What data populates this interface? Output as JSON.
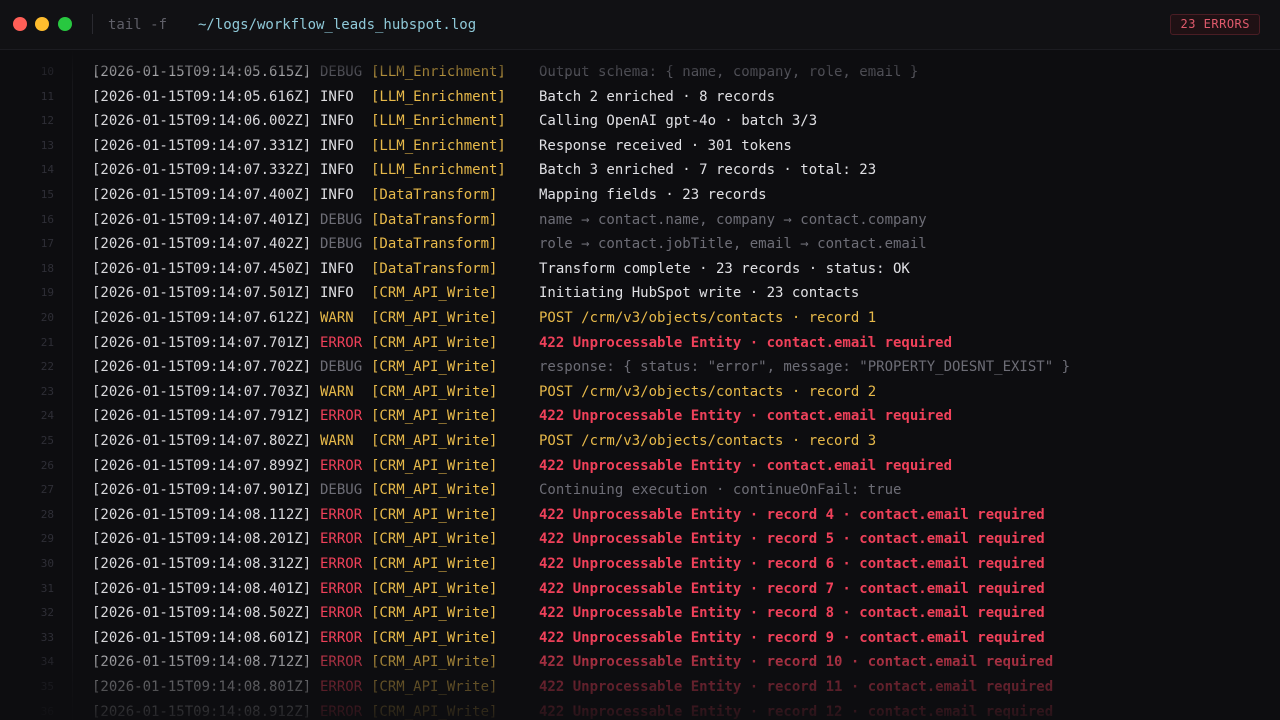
{
  "titlebar": {
    "command": "tail -f",
    "path": "~/logs/workflow_leads_hubspot.log",
    "error_badge": "23 ERRORS"
  },
  "colors": {
    "background": "#0d0d10",
    "info": "#e0e0e4",
    "debug": "#6d6d76",
    "warn": "#e7b94a",
    "error": "#f0415a",
    "source": "#e7b94a",
    "path": "#8fc9d8"
  },
  "log_lines": [
    {
      "n": "10",
      "ts": "[2026-01-15T09:14:05.615Z]",
      "level": "DEBUG",
      "source": "[LLM_Enrichment]",
      "message": "Output schema: { name, company, role, email }"
    },
    {
      "n": "11",
      "ts": "[2026-01-15T09:14:05.616Z]",
      "level": "INFO",
      "source": "[LLM_Enrichment]",
      "message": "Batch 2 enriched · 8 records"
    },
    {
      "n": "12",
      "ts": "[2026-01-15T09:14:06.002Z]",
      "level": "INFO",
      "source": "[LLM_Enrichment]",
      "message": "Calling OpenAI gpt-4o · batch 3/3"
    },
    {
      "n": "13",
      "ts": "[2026-01-15T09:14:07.331Z]",
      "level": "INFO",
      "source": "[LLM_Enrichment]",
      "message": "Response received · 301 tokens"
    },
    {
      "n": "14",
      "ts": "[2026-01-15T09:14:07.332Z]",
      "level": "INFO",
      "source": "[LLM_Enrichment]",
      "message": "Batch 3 enriched · 7 records · total: 23"
    },
    {
      "n": "15",
      "ts": "[2026-01-15T09:14:07.400Z]",
      "level": "INFO",
      "source": "[DataTransform]",
      "message": "Mapping fields · 23 records"
    },
    {
      "n": "16",
      "ts": "[2026-01-15T09:14:07.401Z]",
      "level": "DEBUG",
      "source": "[DataTransform]",
      "message": "name → contact.name, company → contact.company"
    },
    {
      "n": "17",
      "ts": "[2026-01-15T09:14:07.402Z]",
      "level": "DEBUG",
      "source": "[DataTransform]",
      "message": "role → contact.jobTitle, email → contact.email"
    },
    {
      "n": "18",
      "ts": "[2026-01-15T09:14:07.450Z]",
      "level": "INFO",
      "source": "[DataTransform]",
      "message": "Transform complete · 23 records · status: OK"
    },
    {
      "n": "19",
      "ts": "[2026-01-15T09:14:07.501Z]",
      "level": "INFO",
      "source": "[CRM_API_Write]",
      "message": "Initiating HubSpot write · 23 contacts"
    },
    {
      "n": "20",
      "ts": "[2026-01-15T09:14:07.612Z]",
      "level": "WARN",
      "source": "[CRM_API_Write]",
      "message": "POST /crm/v3/objects/contacts · record 1"
    },
    {
      "n": "21",
      "ts": "[2026-01-15T09:14:07.701Z]",
      "level": "ERROR",
      "source": "[CRM_API_Write]",
      "message": "422 Unprocessable Entity · contact.email required"
    },
    {
      "n": "22",
      "ts": "[2026-01-15T09:14:07.702Z]",
      "level": "DEBUG",
      "source": "[CRM_API_Write]",
      "message": "response: { status: \"error\", message: \"PROPERTY_DOESNT_EXIST\" }"
    },
    {
      "n": "23",
      "ts": "[2026-01-15T09:14:07.703Z]",
      "level": "WARN",
      "source": "[CRM_API_Write]",
      "message": "POST /crm/v3/objects/contacts · record 2"
    },
    {
      "n": "24",
      "ts": "[2026-01-15T09:14:07.791Z]",
      "level": "ERROR",
      "source": "[CRM_API_Write]",
      "message": "422 Unprocessable Entity · contact.email required"
    },
    {
      "n": "25",
      "ts": "[2026-01-15T09:14:07.802Z]",
      "level": "WARN",
      "source": "[CRM_API_Write]",
      "message": "POST /crm/v3/objects/contacts · record 3"
    },
    {
      "n": "26",
      "ts": "[2026-01-15T09:14:07.899Z]",
      "level": "ERROR",
      "source": "[CRM_API_Write]",
      "message": "422 Unprocessable Entity · contact.email required"
    },
    {
      "n": "27",
      "ts": "[2026-01-15T09:14:07.901Z]",
      "level": "DEBUG",
      "source": "[CRM_API_Write]",
      "message": "Continuing execution · continueOnFail: true"
    },
    {
      "n": "28",
      "ts": "[2026-01-15T09:14:08.112Z]",
      "level": "ERROR",
      "source": "[CRM_API_Write]",
      "message": "422 Unprocessable Entity · record 4 · contact.email required"
    },
    {
      "n": "29",
      "ts": "[2026-01-15T09:14:08.201Z]",
      "level": "ERROR",
      "source": "[CRM_API_Write]",
      "message": "422 Unprocessable Entity · record 5 · contact.email required"
    },
    {
      "n": "30",
      "ts": "[2026-01-15T09:14:08.312Z]",
      "level": "ERROR",
      "source": "[CRM_API_Write]",
      "message": "422 Unprocessable Entity · record 6 · contact.email required"
    },
    {
      "n": "31",
      "ts": "[2026-01-15T09:14:08.401Z]",
      "level": "ERROR",
      "source": "[CRM_API_Write]",
      "message": "422 Unprocessable Entity · record 7 · contact.email required"
    },
    {
      "n": "32",
      "ts": "[2026-01-15T09:14:08.502Z]",
      "level": "ERROR",
      "source": "[CRM_API_Write]",
      "message": "422 Unprocessable Entity · record 8 · contact.email required"
    },
    {
      "n": "33",
      "ts": "[2026-01-15T09:14:08.601Z]",
      "level": "ERROR",
      "source": "[CRM_API_Write]",
      "message": "422 Unprocessable Entity · record 9 · contact.email required"
    },
    {
      "n": "34",
      "ts": "[2026-01-15T09:14:08.712Z]",
      "level": "ERROR",
      "source": "[CRM_API_Write]",
      "message": "422 Unprocessable Entity · record 10 · contact.email required"
    },
    {
      "n": "35",
      "ts": "[2026-01-15T09:14:08.801Z]",
      "level": "ERROR",
      "source": "[CRM_API_Write]",
      "message": "422 Unprocessable Entity · record 11 · contact.email required"
    },
    {
      "n": "36",
      "ts": "[2026-01-15T09:14:08.912Z]",
      "level": "ERROR",
      "source": "[CRM_API_Write]",
      "message": "422 Unprocessable Entity · record 12 · contact.email required"
    }
  ]
}
